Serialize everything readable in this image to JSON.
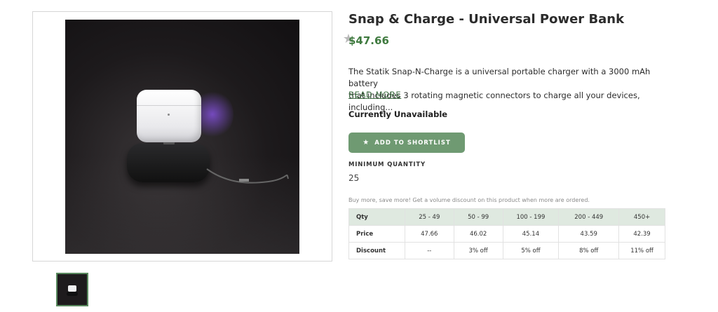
{
  "product": {
    "title": "Snap & Charge - Universal Power Bank",
    "price": "$47.66",
    "description_line1": "The Statik Snap-N-Charge is a universal portable charger with a 3000 mAh battery",
    "description_line2": "that includes 3 rotating magnetic connectors to charge all your devices, including...",
    "read_more": "READ MORE",
    "availability": "Currently Unavailable",
    "add_button_label": "ADD TO SHORTLIST",
    "min_qty_label": "MINIMUM QUANTITY",
    "min_qty_value": "25",
    "volume_note": "Buy more, save more! Get a volume discount on this product when more are ordered."
  },
  "icons": {
    "favorite": "star-icon",
    "add_button_icon": "star-icon"
  },
  "colors": {
    "accent_green": "#6f9a72",
    "price_green": "#3f7a3f",
    "table_header_bg": "#dfe9e0"
  },
  "volume_table": {
    "headers": [
      "Qty",
      "25 - 49",
      "50 - 99",
      "100 - 199",
      "200 - 449",
      "450+"
    ],
    "price_row": [
      "Price",
      "47.66",
      "46.02",
      "45.14",
      "43.59",
      "42.39"
    ],
    "discount_row": [
      "Discount",
      "--",
      "3% off",
      "5% off",
      "8% off",
      "11% off"
    ]
  }
}
